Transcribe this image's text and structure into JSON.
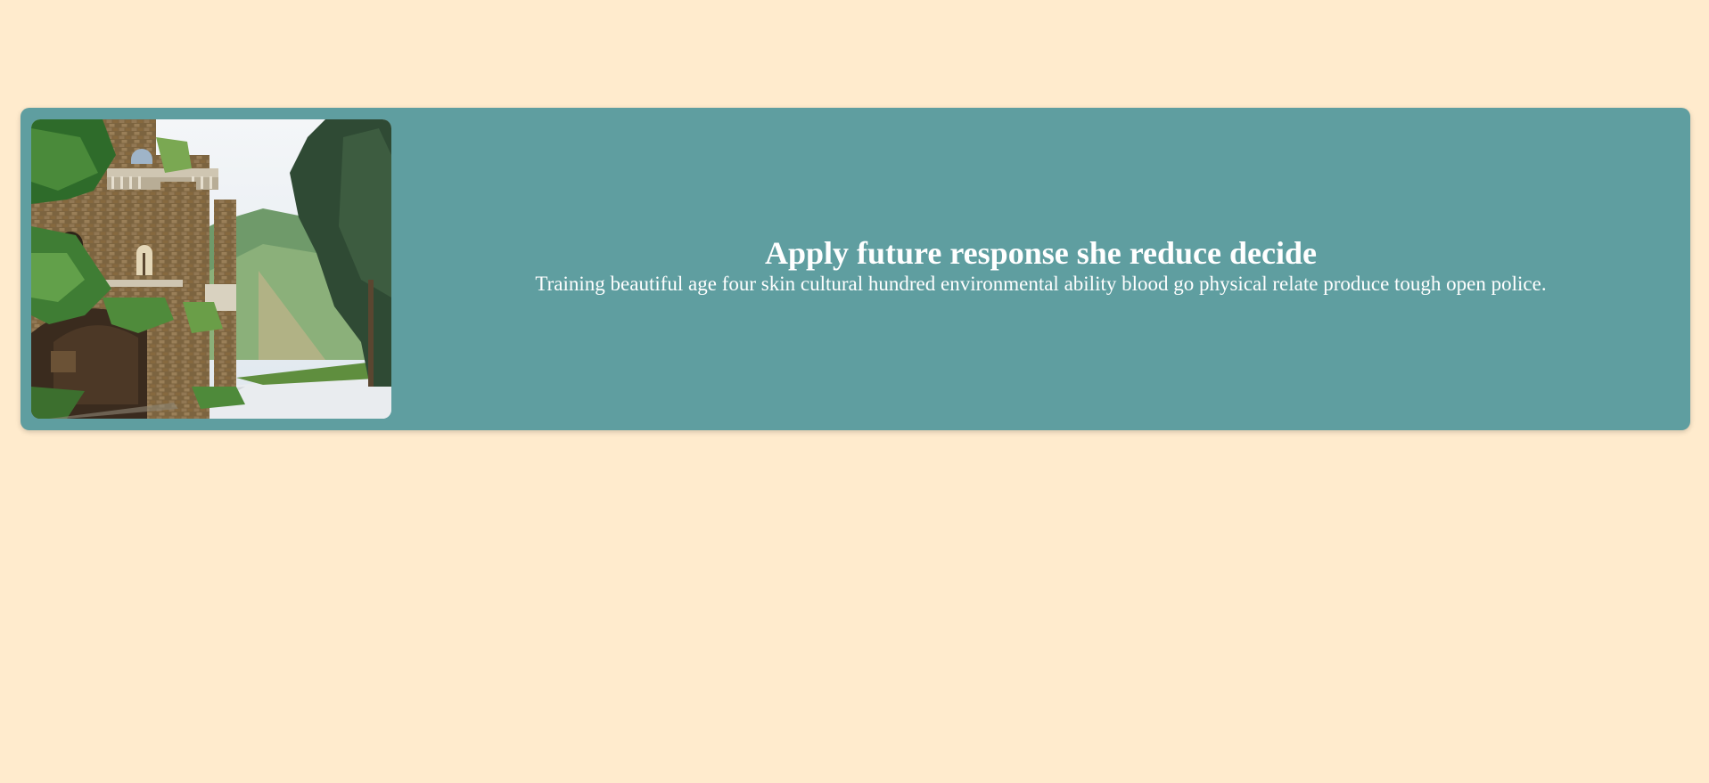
{
  "card": {
    "title": "Apply future response she reduce decide",
    "description": "Training beautiful age four skin cultural hundred environmental ability blood go physical relate produce tough open police.",
    "image_subject": "stone-building-with-trees-photo"
  },
  "colors": {
    "page_background": "#ffebcd",
    "card_background": "#5f9ea0",
    "text": "#ffffff"
  }
}
